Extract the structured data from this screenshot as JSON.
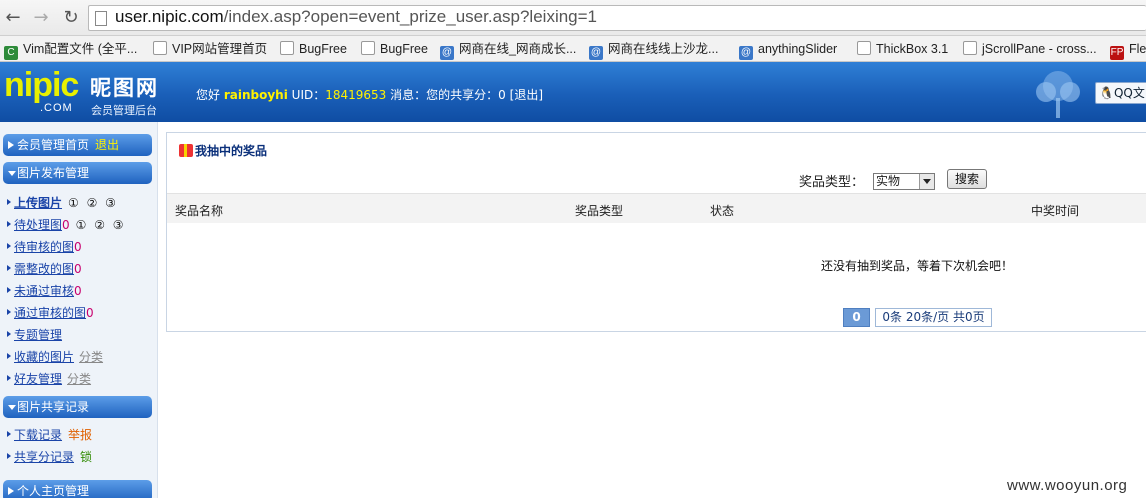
{
  "browser": {
    "url_host": "user.nipic.com",
    "url_path": "/index.asp?open=event_prize_user.asp?leixing=1",
    "bookmarks": [
      {
        "label": "Vim配置文件 (全平...",
        "icon": "vim-icon"
      },
      {
        "label": "VIP网站管理首页",
        "icon": "page-icon"
      },
      {
        "label": "BugFree",
        "icon": "page-icon"
      },
      {
        "label": "BugFree",
        "icon": "page-icon"
      },
      {
        "label": "网商在线_网商成长...",
        "icon": "at-icon"
      },
      {
        "label": "网商在线线上沙龙...",
        "icon": "at-icon"
      },
      {
        "label": "anythingSlider",
        "icon": "at-icon"
      },
      {
        "label": "ThickBox 3.1",
        "icon": "page-icon"
      },
      {
        "label": "jScrollPane - cross...",
        "icon": "page-icon"
      },
      {
        "label": "Fle",
        "icon": "fp-icon"
      }
    ]
  },
  "header": {
    "logo_en": "nipic",
    "logo_com": ".COM",
    "logo_cn": "昵图网",
    "logo_sub": "会员管理后台",
    "greeting": "您好",
    "username": "rainboyhi",
    "uid_label": "UID：",
    "uid": "18419653",
    "messages_label": "消息：",
    "share_label": "您的共享分：",
    "share_value": "0",
    "logout": "[退出]",
    "qq_label": "QQ文"
  },
  "sidebar": {
    "home": "会员管理首页",
    "home_exit": "退出",
    "section1": "图片发布管理",
    "upload": "上传图片",
    "circles": "① ② ③",
    "pending_process": "待处理图",
    "pending_process_count": "0",
    "pending_review": "待审核的图",
    "pending_review_count": "0",
    "need_fix": "需整改的图",
    "need_fix_count": "0",
    "not_passed": "未通过审核",
    "not_passed_count": "0",
    "passed": "通过审核的图",
    "passed_count": "0",
    "topics": "专题管理",
    "favorites": "收藏的图片",
    "favorites_extra": "分类",
    "friends": "好友管理",
    "friends_extra": "分类",
    "section2": "图片共享记录",
    "downloads": "下载记录",
    "downloads_extra": "举报",
    "share_records": "共享分记录",
    "share_records_extra": "锁",
    "section3": "个人主页管理"
  },
  "main": {
    "title": "我抽中的奖品",
    "filter_label": "奖品类型：",
    "filter_selected": "实物",
    "search_button": "搜索",
    "columns": [
      "奖品名称",
      "奖品类型",
      "状态",
      "中奖时间"
    ],
    "empty_message": "还没有抽到奖品，等着下次机会吧！",
    "pagination_current": "0",
    "pagination_info": "0条 20条/页 共0页"
  },
  "watermark": "www.wooyun.org"
}
